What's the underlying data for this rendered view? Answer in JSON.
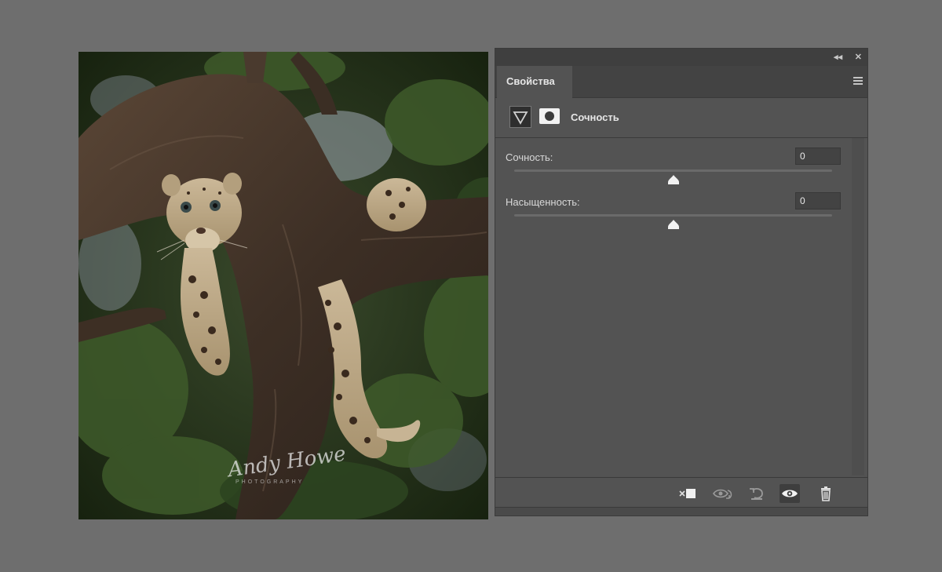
{
  "photo": {
    "subject": "leopard-cub-in-tree",
    "watermark_signature": "Andy Howe",
    "watermark_sub": "PHOTOGRAPHY"
  },
  "panel": {
    "collapse_glyph": "◂◂",
    "close_glyph": "✕",
    "tab_label": "Свойства",
    "layer_name": "Сочность",
    "rows": [
      {
        "label": "Сочность:",
        "value": "0",
        "slider_percent": 50
      },
      {
        "label": "Насыщенность:",
        "value": "0",
        "slider_percent": 50
      }
    ],
    "bottom_icons": [
      "clip-to-layer-icon",
      "view-previous-state-icon",
      "reset-icon",
      "visibility-eye-icon",
      "trash-icon"
    ]
  },
  "colors": {
    "workspace": "#6e6e6e",
    "panel_bg": "#535353",
    "panel_header": "#3f3f3f",
    "text": "#e6e6e6"
  }
}
